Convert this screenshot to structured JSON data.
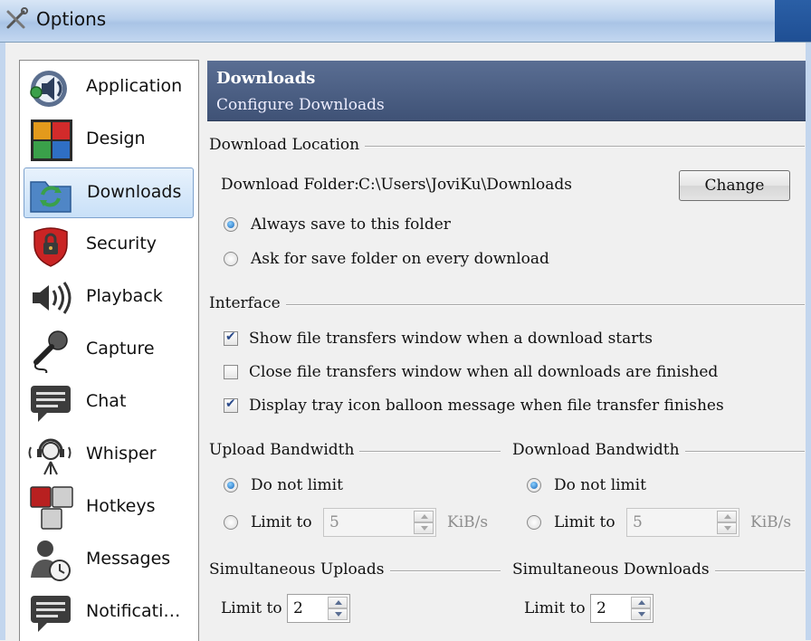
{
  "window": {
    "title": "Options"
  },
  "sidebar": {
    "items": [
      {
        "label": "Application",
        "icon": "speaker-app-icon"
      },
      {
        "label": "Design",
        "icon": "color-squares-icon"
      },
      {
        "label": "Downloads",
        "icon": "folder-sync-icon",
        "selected": true
      },
      {
        "label": "Security",
        "icon": "shield-lock-icon"
      },
      {
        "label": "Playback",
        "icon": "speaker-volume-icon"
      },
      {
        "label": "Capture",
        "icon": "microphone-icon"
      },
      {
        "label": "Chat",
        "icon": "chat-bubble-icon"
      },
      {
        "label": "Whisper",
        "icon": "headset-icon"
      },
      {
        "label": "Hotkeys",
        "icon": "keys-icon"
      },
      {
        "label": "Messages",
        "icon": "user-clock-icon"
      },
      {
        "label": "Notificati…",
        "icon": "notification-bubble-icon"
      }
    ]
  },
  "header": {
    "title": "Downloads",
    "subtitle": "Configure Downloads"
  },
  "download_location": {
    "group_title": "Download Location",
    "folder_label": "Download Folder:",
    "folder_path": "C:\\Users\\JoviKu\\Downloads",
    "change_button": "Change",
    "options": [
      {
        "label": "Always save to this folder",
        "checked": true
      },
      {
        "label": "Ask for save folder on every download",
        "checked": false
      }
    ]
  },
  "interface": {
    "group_title": "Interface",
    "checkboxes": [
      {
        "label": "Show file transfers window when a download starts",
        "checked": true
      },
      {
        "label": "Close file transfers window when all downloads are finished",
        "checked": false
      },
      {
        "label": "Display tray icon balloon message when file transfer finishes",
        "checked": true
      }
    ]
  },
  "upload_bandwidth": {
    "group_title": "Upload Bandwidth",
    "no_limit_label": "Do not limit",
    "limit_label": "Limit to",
    "limit_value": "5",
    "unit": "KiB/s",
    "selected": "no_limit"
  },
  "download_bandwidth": {
    "group_title": "Download Bandwidth",
    "no_limit_label": "Do not limit",
    "limit_label": "Limit to",
    "limit_value": "5",
    "unit": "KiB/s",
    "selected": "no_limit"
  },
  "simultaneous_uploads": {
    "group_title": "Simultaneous Uploads",
    "limit_label": "Limit to",
    "value": "2"
  },
  "simultaneous_downloads": {
    "group_title": "Simultaneous Downloads",
    "limit_label": "Limit to",
    "value": "2"
  },
  "colors": {
    "header_bg": "#4b5e84",
    "selected_bg": "#cfe4f9",
    "window_bg": "#f0f0f0"
  }
}
